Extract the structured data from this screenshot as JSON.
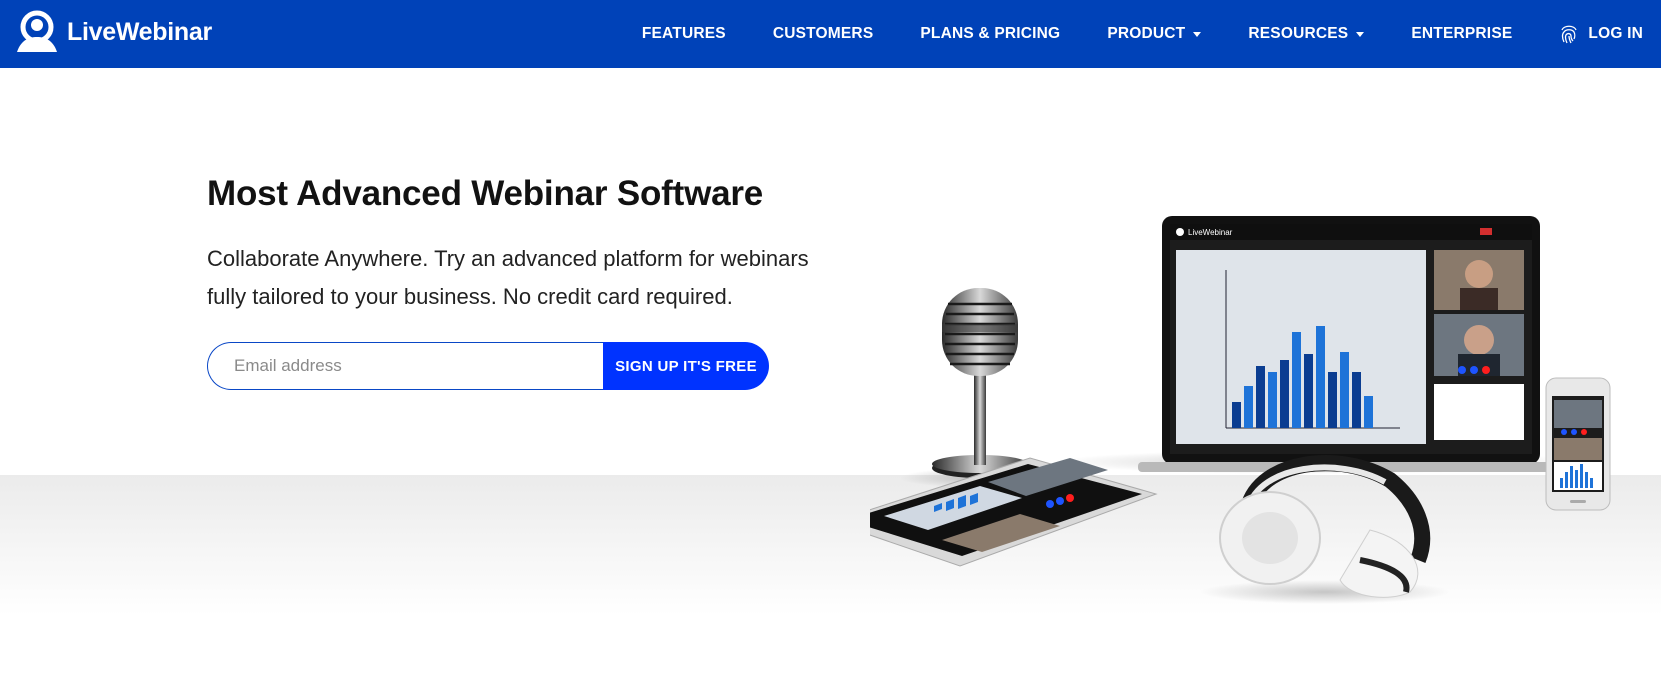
{
  "brand": {
    "name": "LiveWebinar"
  },
  "nav": {
    "items": [
      {
        "label": "FEATURES"
      },
      {
        "label": "CUSTOMERS"
      },
      {
        "label": "PLANS & PRICING"
      },
      {
        "label": "PRODUCT"
      },
      {
        "label": "RESOURCES"
      },
      {
        "label": "ENTERPRISE"
      }
    ],
    "login": "LOG IN"
  },
  "hero": {
    "title": "Most Advanced Webinar Software",
    "subtitle_line1": "Collaborate Anywhere. Try an advanced platform for webinars",
    "subtitle_line2": "fully tailored to your business. No credit card required.",
    "email_placeholder": "Email address",
    "cta_label": "SIGN UP IT'S FREE"
  },
  "illustration": {
    "laptop_brand": "LiveWebinar"
  },
  "colors": {
    "header_bg": "#0042b8",
    "cta_bg": "#0033ff",
    "input_border": "#0a47c6"
  },
  "icons": [
    "logo-icon",
    "chevron-down-icon",
    "fingerprint-icon"
  ]
}
